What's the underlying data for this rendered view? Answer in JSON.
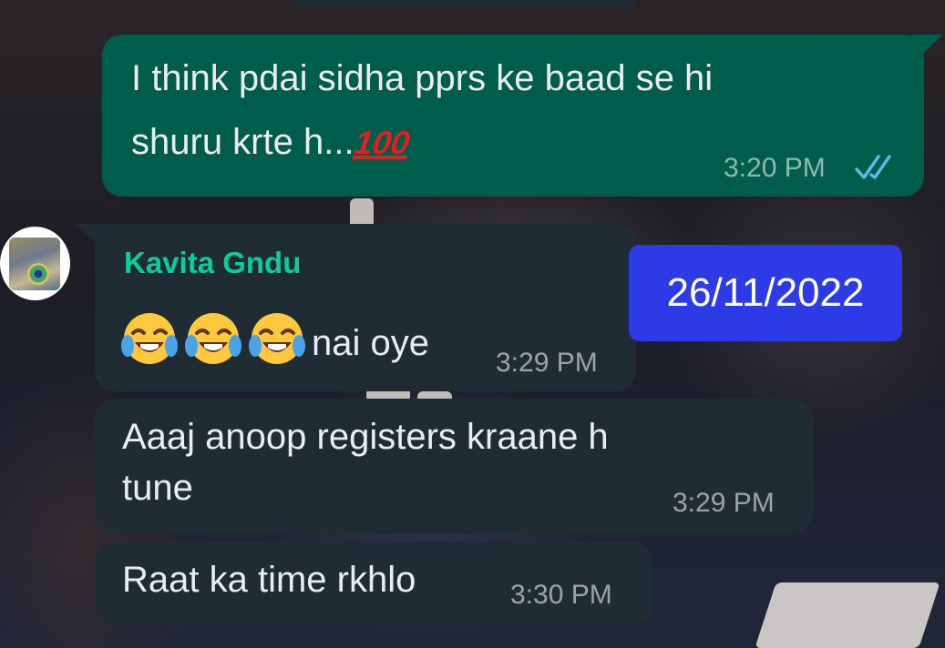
{
  "chat": {
    "date_badge": "26/11/2022",
    "messages": [
      {
        "direction": "outgoing",
        "lines": [
          "I think pdai sidha pprs ke baad se hi",
          "shuru krte h..."
        ],
        "emoji_suffix": "100-emoji",
        "emoji_text": "100",
        "time": "3:20 PM",
        "status": "read"
      },
      {
        "direction": "incoming",
        "sender": "Kavita Gndu",
        "sender_color": "#06cf9c",
        "emojis": [
          "face-with-tears-of-joy",
          "face-with-tears-of-joy",
          "face-with-tears-of-joy"
        ],
        "text": "nai oye",
        "time": "3:29 PM"
      },
      {
        "direction": "incoming",
        "lines": [
          "Aaaj anoop registers kraane h",
          "tune"
        ],
        "time": "3:29 PM"
      },
      {
        "direction": "incoming",
        "text": "Raat ka time rkhlo",
        "time": "3:30 PM"
      }
    ]
  },
  "colors": {
    "outgoing_bubble": "#005c4b",
    "incoming_bubble": "#202c33",
    "read_ticks": "#53bdeb",
    "date_badge": "#2d3be6"
  },
  "icons": {
    "read_status": "double-check-icon",
    "avatar": "contact-avatar"
  }
}
